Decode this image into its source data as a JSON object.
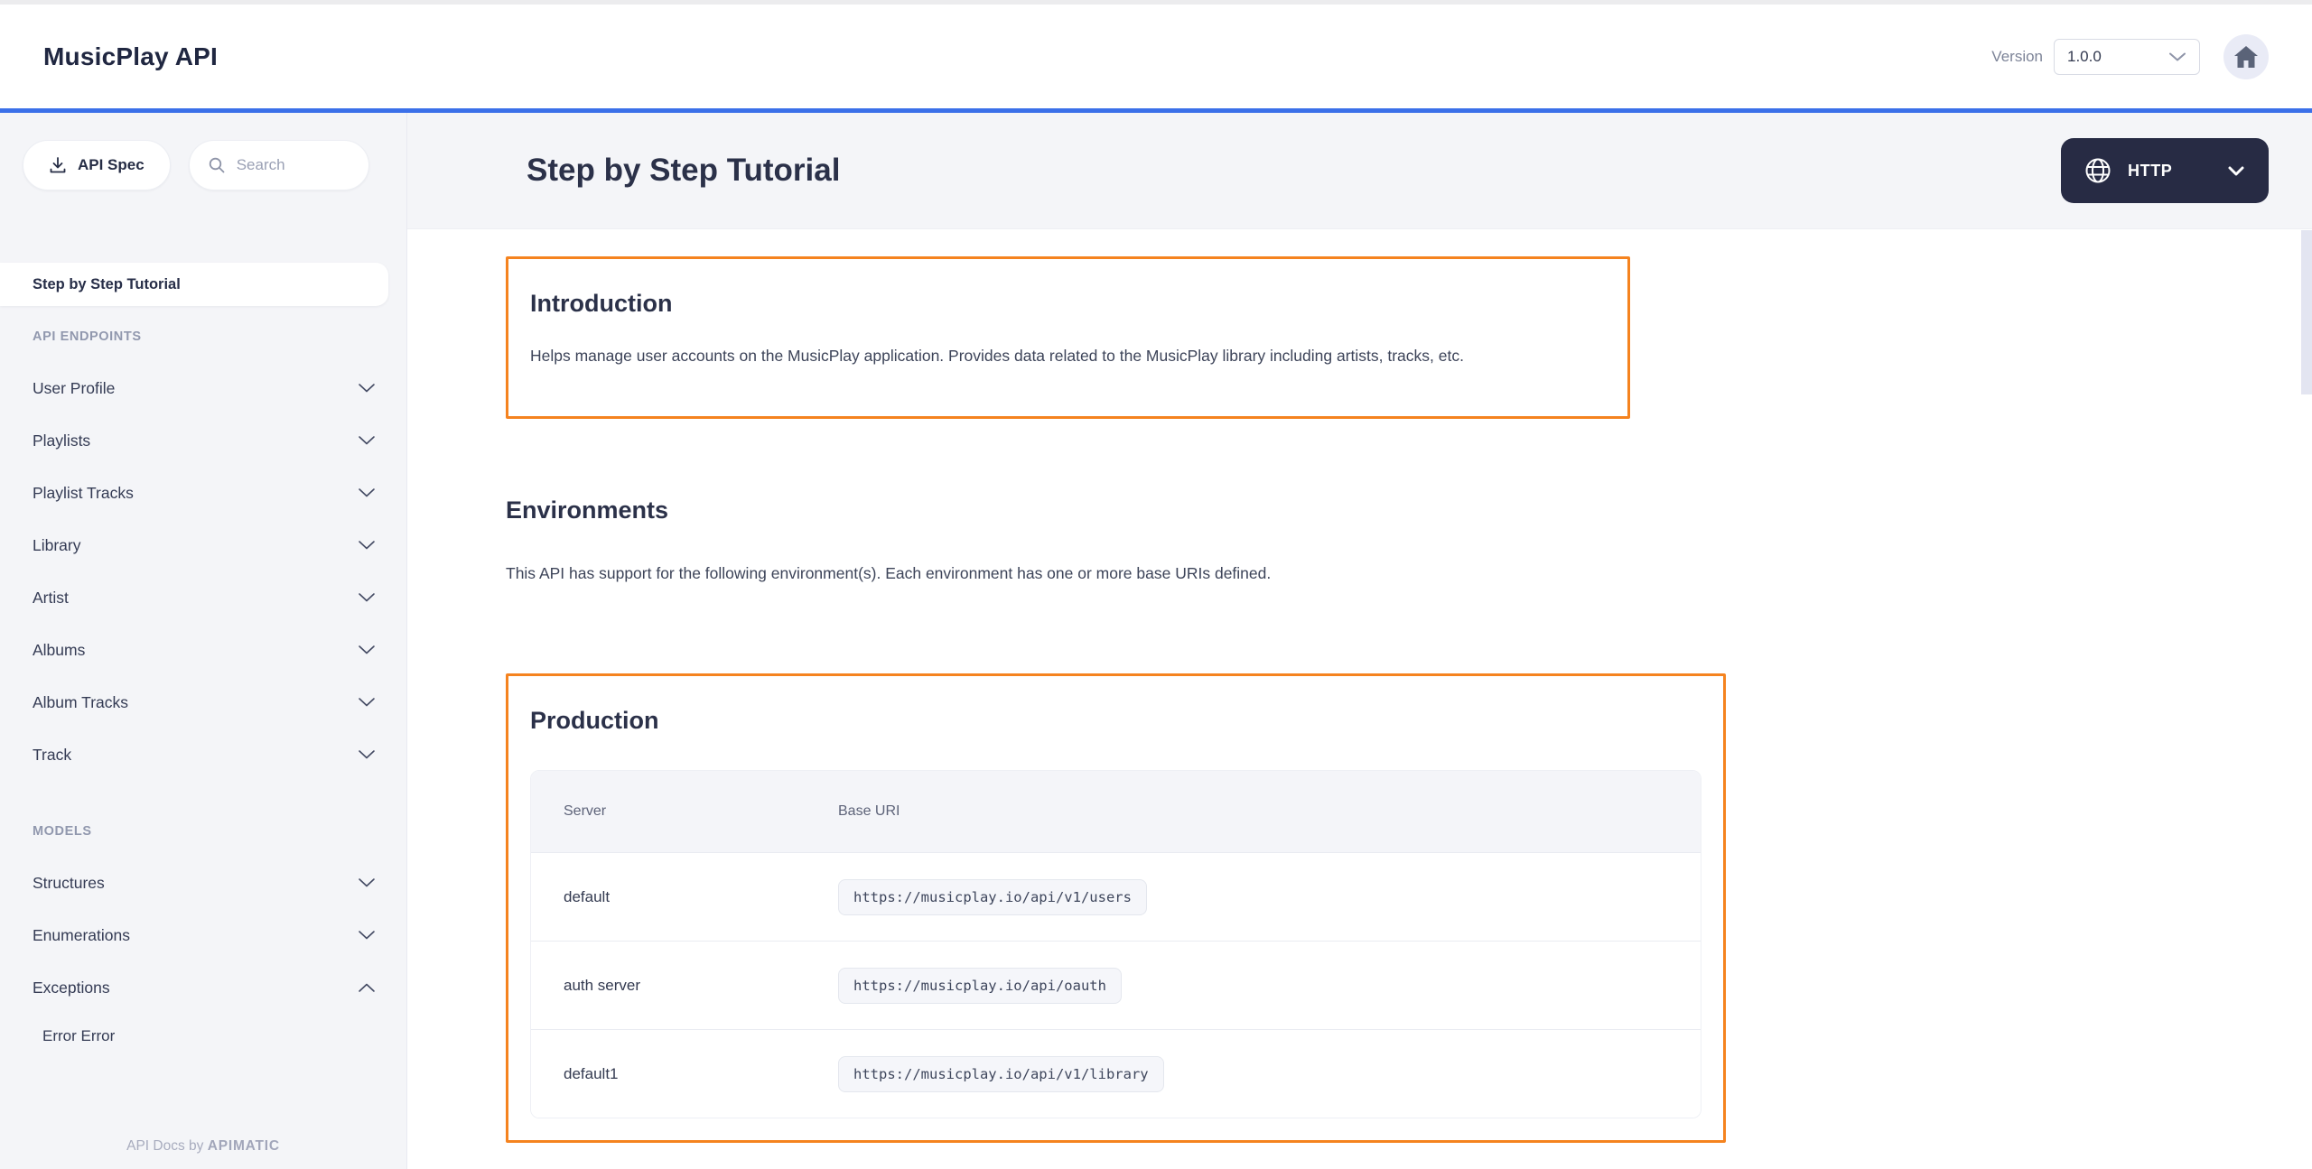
{
  "header": {
    "app_title": "MusicPlay API",
    "version_label": "Version",
    "version_value": "1.0.0"
  },
  "sidebar": {
    "api_spec_label": "API Spec",
    "search_placeholder": "Search",
    "tutorial_item": "Step by Step Tutorial",
    "endpoints": {
      "label": "API ENDPOINTS",
      "items": [
        "User Profile",
        "Playlists",
        "Playlist Tracks",
        "Library",
        "Artist",
        "Albums",
        "Album Tracks",
        "Track"
      ]
    },
    "models": {
      "label": "MODELS",
      "items": [
        "Structures",
        "Enumerations",
        "Exceptions"
      ],
      "sub_item": "Error Error"
    },
    "footer": {
      "prefix": "API Docs by ",
      "brand": "APIMATIC"
    }
  },
  "main": {
    "page_title": "Step by Step Tutorial",
    "language": "HTTP",
    "introduction": {
      "title": "Introduction",
      "body": "Helps manage user accounts on the MusicPlay application. Provides data related to the MusicPlay library including artists, tracks, etc."
    },
    "environments": {
      "title": "Environments",
      "body": "This API has support for the following environment(s). Each environment has one or more base URIs defined."
    },
    "production": {
      "title": "Production",
      "table": {
        "columns": [
          "Server",
          "Base URI"
        ],
        "rows": [
          {
            "server": "default",
            "base_uri": "https://musicplay.io/api/v1/users"
          },
          {
            "server": "auth server",
            "base_uri": "https://musicplay.io/api/oauth"
          },
          {
            "server": "default1",
            "base_uri": "https://musicplay.io/api/v1/library"
          }
        ]
      }
    }
  },
  "icons": {
    "download": "download-icon",
    "search": "search-icon",
    "globe": "globe-icon",
    "home": "home-icon",
    "chevron_down": "chevron-down-icon",
    "chevron_up": "chevron-up-icon"
  },
  "colors": {
    "accent_orange": "#F5831F",
    "accent_blue": "#3B70E9",
    "dark_button": "#272B44",
    "page_background": "#F4F5F8"
  }
}
